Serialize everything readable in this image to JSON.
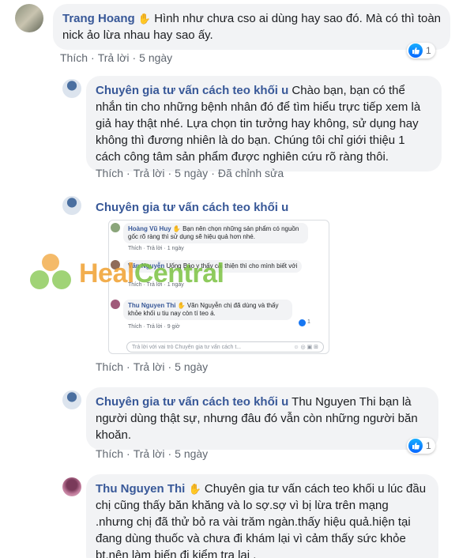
{
  "comments": [
    {
      "author": "Trang Hoang",
      "text": "Hình như chưa cso ai dùng hay sao đó. Mà có thì toàn nick ảo lừa nhau hay sao ấy.",
      "actions": {
        "like": "Thích",
        "reply": "Trả lời",
        "time": "5 ngày"
      },
      "reactions": "1"
    },
    {
      "author": "Chuyên gia tư vấn cách teo khối u",
      "text": "Chào bạn, bạn có thể nhắn tin cho những bệnh nhân đó để tìm hiểu trực tiếp xem là giả hay thật nhé. Lựa chọn tin tưởng hay không, sử dụng hay không thì đương nhiên là do bạn. Chúng tôi chỉ giới thiệu 1 cách công tâm sản phẩm được nghiên cứu rõ ràng thôi.",
      "actions": {
        "like": "Thích",
        "reply": "Trả lời",
        "time": "5 ngày",
        "edited": "Đã chỉnh sửa"
      }
    },
    {
      "author": "Chuyên gia tư vấn cách teo khối u",
      "actions": {
        "like": "Thích",
        "reply": "Trả lời",
        "time": "5 ngày"
      },
      "embedded": {
        "c1": {
          "author": "Hoàng Vũ Huy",
          "text": "Bạn nên chọn những sản phẩm có nguồn gốc rõ ràng thì sử dụng sẽ hiệu quả hơn nhé.",
          "actions": "Thích · Trả lời · 1 ngày"
        },
        "c2": {
          "author": "Văn Nguyễn",
          "text": "Uống Bảo y thấy cải thiện thì cho mình biết với",
          "actions": "Thích · Trả lời · 1 ngày"
        },
        "c3": {
          "author": "Thu Nguyen Thi",
          "text": "Văn Nguyễn chị đã dùng và thấy khỏe khối u tiu nay còn tí teo á.",
          "actions": "Thích · Trả lời · 9 giờ",
          "reactions": "1"
        },
        "reply_placeholder": "Trả lời với vai trò Chuyên gia tư vấn cách t..."
      }
    },
    {
      "author": "Chuyên gia tư vấn cách teo khối u",
      "text": "Thu Nguyen Thi bạn là người dùng thật sự, nhưng đâu đó vẫn còn những người băn khoăn.",
      "actions": {
        "like": "Thích",
        "reply": "Trả lời",
        "time": "5 ngày"
      },
      "reactions": "1"
    },
    {
      "author": "Thu Nguyen Thi",
      "text": "Chuyên gia tư vấn cách teo khối u lúc đầu chị cũng thấy băn khăng và lo sợ.sợ vì bị lừa trên mạng .nhưng chị đã thử bỏ ra vài trăm ngàn.thấy hiệu quả.hiện tại đang dùng thuốc và chưa đi khám lại vì cảm thấy sức khỏe bt.nên làm biến đi kiểm tra lại ."
    }
  ],
  "watermark": {
    "part1": "Heal",
    "part2": "Central"
  },
  "colors": {
    "author": "#385898",
    "bubble": "#f2f3f5",
    "like": "#1877f2",
    "wm_green": "#7cc242",
    "wm_orange": "#f0a030"
  }
}
